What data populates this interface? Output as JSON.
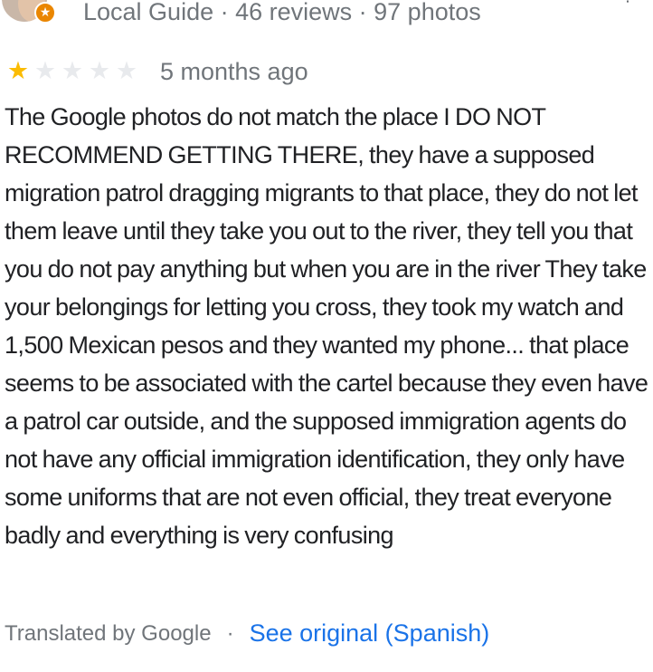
{
  "reviewer": {
    "guide_line": "Local Guide · 46 reviews · 97 photos"
  },
  "rating": {
    "value": 1,
    "max": 5
  },
  "review": {
    "date": "5 months ago",
    "text": "The Google photos do not match the place I DO NOT RECOMMEND GETTING THERE, they have a supposed migration patrol dragging migrants to that place, they do not let them leave until they take you out to the river, they tell you that you do not pay anything but when you are in the river They take your belongings for letting you cross, they took my watch and 1,500 Mexican pesos and they wanted my phone... that place seems to be associated with the cartel because they even have a patrol car outside, and the supposed immigration agents do not have any official immigration identification, they only have some uniforms that are not even official, they treat everyone badly and everything is very confusing"
  },
  "translation": {
    "label": "Translated by Google",
    "separator": "·",
    "see_original": "See original (Spanish)"
  },
  "icons": {
    "avatar": "avatar",
    "guide_badge": "local-guide-star-icon",
    "more": "more-vert-icon",
    "star": "star-icon"
  },
  "colors": {
    "star_filled": "#fbbc04",
    "star_empty": "#e8eaed",
    "link": "#1a73e8",
    "muted_text": "#70757a",
    "body_text": "#202124",
    "badge": "#ea8600"
  }
}
